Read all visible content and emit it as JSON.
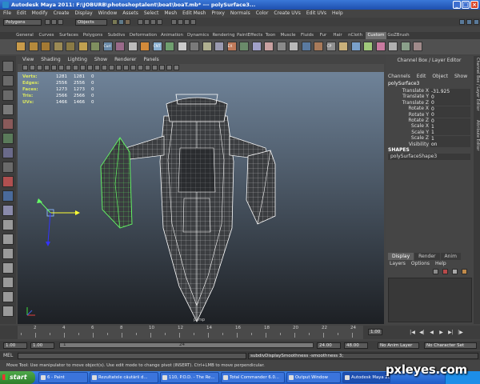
{
  "window": {
    "title": "Autodesk Maya 2011: F:\\JOBURB\\photoshoptalent\\boat\\boaT.mb* --- polySurface3...",
    "buttons": {
      "minimize": "_",
      "maximize": "□",
      "close": "×"
    }
  },
  "menubar": [
    "File",
    "Edit",
    "Modify",
    "Create",
    "Display",
    "Window",
    "Assets",
    "Select",
    "Mesh",
    "Edit Mesh",
    "Proxy",
    "Normals",
    "Color",
    "Create UVs",
    "Edit UVs",
    "Help"
  ],
  "status_line": {
    "mode_menu": "Polygons",
    "selection_field": "Objects"
  },
  "shelf_tabs": {
    "items": [
      "General",
      "Curves",
      "Surfaces",
      "Polygons",
      "Subdivs",
      "Deformation",
      "Animation",
      "Dynamics",
      "Rendering",
      "PaintEffects",
      "Toon",
      "Muscle",
      "Fluids",
      "Fur",
      "Hair",
      "nCloth",
      "Custom",
      "GoZBrush"
    ],
    "active": "Custom"
  },
  "shelf_icon_labels": [
    "Curl",
    "CNT",
    "EX",
    "CP"
  ],
  "viewport": {
    "menu": [
      "View",
      "Shading",
      "Lighting",
      "Show",
      "Renderer",
      "Panels"
    ],
    "hud_rows": [
      {
        "label": "Verts:",
        "values": [
          "1281",
          "1281",
          "0"
        ]
      },
      {
        "label": "Edges:",
        "values": [
          "2556",
          "2556",
          "0"
        ]
      },
      {
        "label": "Faces:",
        "values": [
          "1273",
          "1273",
          "0"
        ]
      },
      {
        "label": "Tris:",
        "values": [
          "2566",
          "2566",
          "0"
        ]
      },
      {
        "label": "UVs:",
        "values": [
          "1466",
          "1466",
          "0"
        ]
      }
    ],
    "camera_label": "persp"
  },
  "channel_box": {
    "header": "Channel Box / Layer Editor",
    "menu": [
      "Channels",
      "Edit",
      "Object",
      "Show"
    ],
    "object_name": "polySurface3",
    "attributes": [
      {
        "name": "Translate X",
        "value": "-31.925"
      },
      {
        "name": "Translate Y",
        "value": "0"
      },
      {
        "name": "Translate Z",
        "value": "0"
      },
      {
        "name": "Rotate X",
        "value": "0"
      },
      {
        "name": "Rotate Y",
        "value": "0"
      },
      {
        "name": "Rotate Z",
        "value": "0"
      },
      {
        "name": "Scale X",
        "value": "1"
      },
      {
        "name": "Scale Y",
        "value": "1"
      },
      {
        "name": "Scale Z",
        "value": "1"
      },
      {
        "name": "Visibility",
        "value": "on"
      }
    ],
    "shapes_header": "SHAPES",
    "shape_name": "polySurfaceShape3"
  },
  "side_strip": {
    "channel_box_label": "Channel Box / Layer Editor",
    "attribute_editor_label": "Attribute Editor"
  },
  "layer_editor": {
    "tabs": [
      "Display",
      "Render",
      "Anim"
    ],
    "active_tab": "Display",
    "menu": [
      "Layers",
      "Options",
      "Help"
    ]
  },
  "time_slider": {
    "ticks": [
      "2",
      "4",
      "6",
      "8",
      "10",
      "12",
      "14",
      "16",
      "18",
      "20",
      "22",
      "24"
    ],
    "current_frame": "1.00",
    "playback_buttons": [
      "|◀",
      "◀|",
      "◀",
      "▶",
      "▶|",
      "|▶"
    ]
  },
  "range_slider": {
    "start_time": "1.00",
    "playback_start": "1.00",
    "range_start_label": "1",
    "range_end_label": "24",
    "playback_end": "24.00",
    "end_time": "48.00",
    "anim_layer": "No Anim Layer",
    "character_set": "No Character Set"
  },
  "command_line": {
    "label": "MEL",
    "result": "subdivDisplaySmoothness -smoothness 3;"
  },
  "help_line": "Move Tool: Use manipulator to move object(s). Use edit mode to change pivot (INSERT). Ctrl+LMB to move perpendicular.",
  "taskbar": {
    "start_label": "start",
    "tasks": [
      {
        "label": "6 - Paint",
        "active": false
      },
      {
        "label": "Rezultatele căutării d...",
        "active": false
      },
      {
        "label": "110, P.O.D. - The Re...",
        "active": false
      },
      {
        "label": "Total Commander 6.0...",
        "active": false
      },
      {
        "label": "Output Window",
        "active": false
      },
      {
        "label": "Autodesk Maya 2011:...",
        "active": true
      }
    ]
  },
  "watermark": "pxleyes.com",
  "colors": {
    "wire": "#ffffff",
    "selected_wire": "#66ff66",
    "hud_label": "#dbe860",
    "viewport_top": "#6f8399",
    "viewport_bottom": "#1d2024"
  }
}
